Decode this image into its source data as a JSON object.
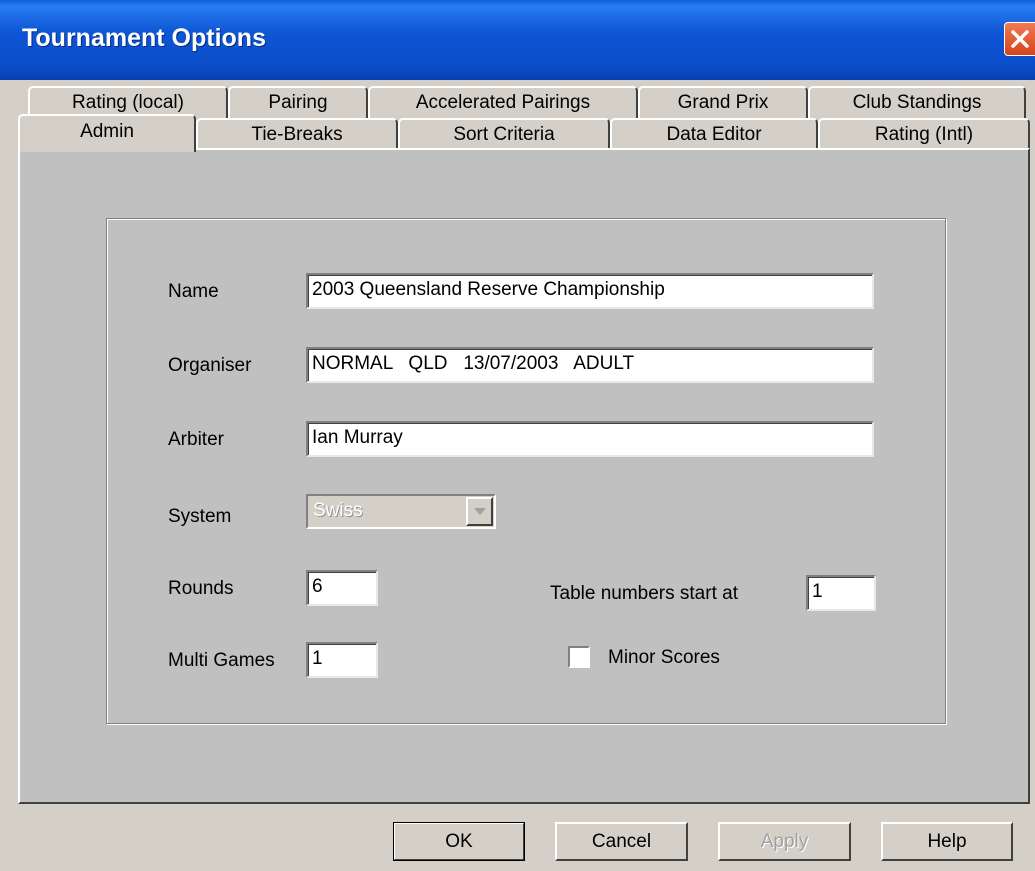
{
  "window": {
    "title": "Tournament Options"
  },
  "tabs_back": [
    {
      "label": "Rating (local)"
    },
    {
      "label": "Pairing"
    },
    {
      "label": "Accelerated Pairings"
    },
    {
      "label": "Grand Prix"
    },
    {
      "label": "Club Standings"
    }
  ],
  "tabs_front": [
    {
      "label": "Admin",
      "active": true
    },
    {
      "label": "Tie-Breaks"
    },
    {
      "label": "Sort Criteria"
    },
    {
      "label": "Data Editor"
    },
    {
      "label": "Rating (Intl)"
    }
  ],
  "form": {
    "name": {
      "label": "Name",
      "value": "2003 Queensland Reserve Championship"
    },
    "organiser": {
      "label": "Organiser",
      "value": "NORMAL   QLD   13/07/2003   ADULT"
    },
    "arbiter": {
      "label": "Arbiter",
      "value": "Ian Murray"
    },
    "system": {
      "label": "System",
      "value": "Swiss",
      "disabled": true
    },
    "rounds": {
      "label": "Rounds",
      "value": "6"
    },
    "multi_games": {
      "label": "Multi Games",
      "value": "1"
    },
    "table_numbers": {
      "label": "Table numbers start at",
      "value": "1"
    },
    "minor_scores": {
      "label": "Minor Scores",
      "checked": false
    }
  },
  "buttons": {
    "ok": "OK",
    "cancel": "Cancel",
    "apply": "Apply",
    "help": "Help"
  },
  "icons": {
    "close": "close-icon",
    "dropdown": "chevron-down-icon"
  },
  "colors": {
    "titlebar": "#0a4cc8",
    "close_button": "#d8431b",
    "face": "#d4d0c8",
    "panel": "#c0c0c0"
  }
}
